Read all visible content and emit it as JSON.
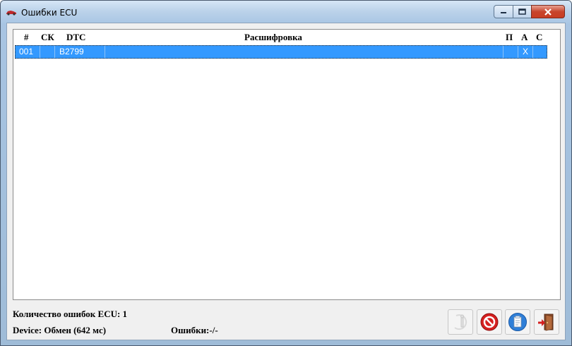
{
  "window": {
    "title": "Ошибки ECU"
  },
  "grid": {
    "headers": {
      "num": "#",
      "ck": "СК",
      "dtc": "DTC",
      "desc": "Расшифровка",
      "p": "П",
      "a": "А",
      "c": "С"
    },
    "rows": [
      {
        "num": "001",
        "ck": "",
        "dtc": "B2799",
        "desc": "",
        "p": "",
        "a": "X",
        "c": ""
      }
    ]
  },
  "status": {
    "count_label": "Количество ошибок ECU: 1",
    "device_label": "Device: Обмен (642 мс)",
    "errors_label": "Ошибки:-/-"
  },
  "colors": {
    "selection": "#3399ff",
    "close_button": "#c7452c",
    "window_frame": "#a9c6e4"
  },
  "toolbar": {
    "icons": [
      "timer-icon",
      "stop-icon",
      "clipboard-icon",
      "exit-door-icon"
    ]
  }
}
